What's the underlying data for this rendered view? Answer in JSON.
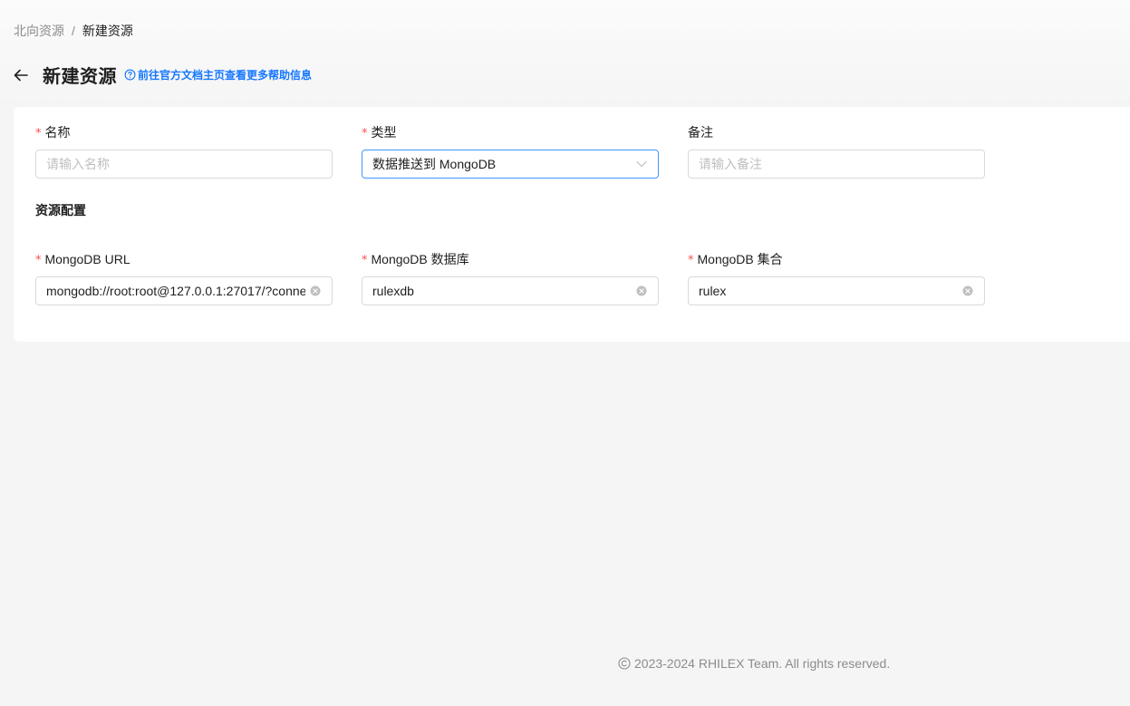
{
  "breadcrumb": {
    "parent": "北向资源",
    "separator": "/",
    "current": "新建资源"
  },
  "header": {
    "back_icon": "arrow-left-icon",
    "title": "新建资源",
    "help_icon": "question-circle-icon",
    "help_text": "前往官方文档主页查看更多帮助信息"
  },
  "form": {
    "name": {
      "label": "名称",
      "required_mark": "*",
      "placeholder": "请输入名称",
      "value": ""
    },
    "type": {
      "label": "类型",
      "required_mark": "*",
      "value": "数据推送到 MongoDB",
      "suffix_icon": "chevron-down-icon"
    },
    "remark": {
      "label": "备注",
      "placeholder": "请输入备注",
      "value": ""
    },
    "section_title": "资源配置",
    "mongo_url": {
      "label": "MongoDB URL",
      "required_mark": "*",
      "value": "mongodb://root:root@127.0.0.1:27017/?conne",
      "suffix_icon": "clear-circle-icon"
    },
    "mongo_db": {
      "label": "MongoDB 数据库",
      "required_mark": "*",
      "value": "rulexdb",
      "suffix_icon": "clear-circle-icon"
    },
    "mongo_collection": {
      "label": "MongoDB 集合",
      "required_mark": "*",
      "value": "rulex",
      "suffix_icon": "clear-circle-icon"
    }
  },
  "footer": {
    "icon": "copyright-icon",
    "text": "2023-2024 RHILEX Team. All rights reserved."
  },
  "colors": {
    "primary": "#1677ff",
    "required": "#ff4d4f",
    "focus_border": "#4096ff",
    "page_bg": "#f5f5f5"
  }
}
